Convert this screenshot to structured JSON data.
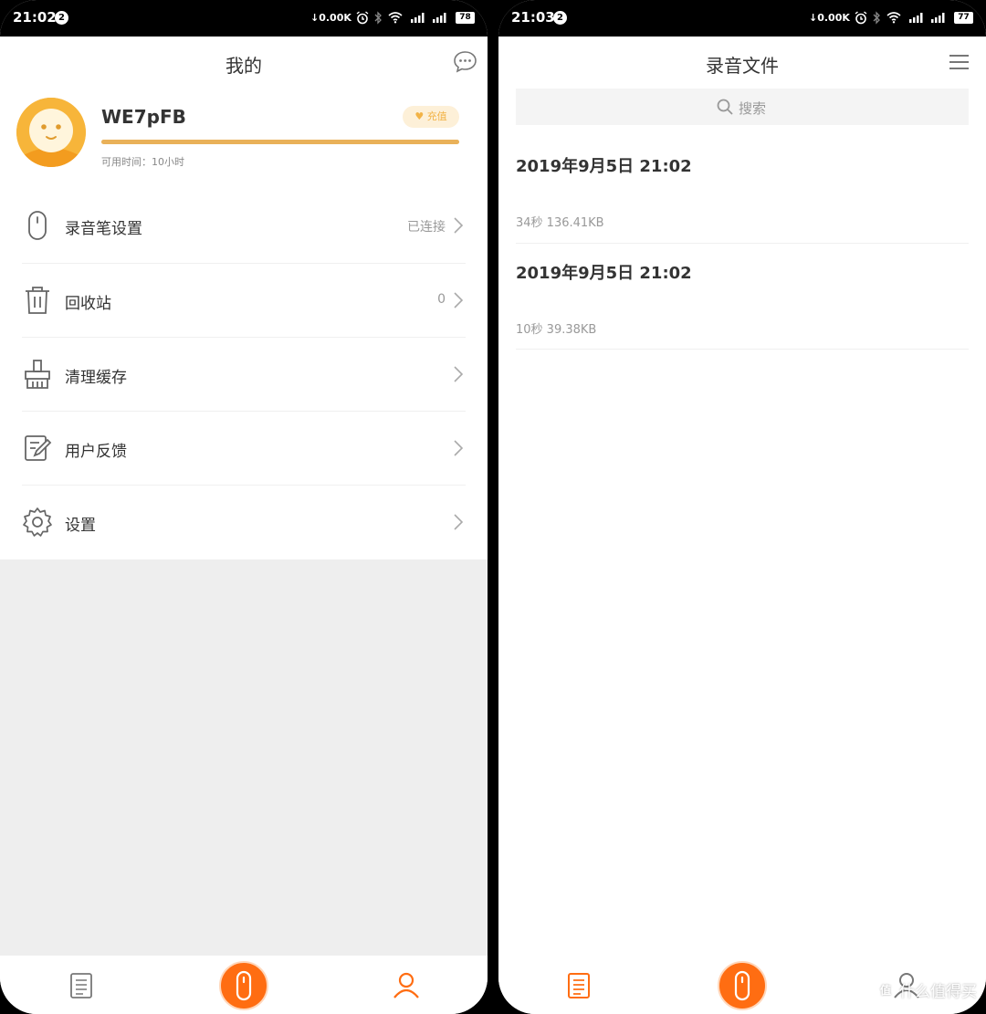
{
  "colors": {
    "accent": "#ff6d12",
    "gold": "#e9b159",
    "vip_bg": "#fdf0d8",
    "grey_bg": "#eeeeee"
  },
  "left": {
    "status": {
      "time": "21:02",
      "notification": "2",
      "speed": "↓0.00K",
      "battery": "78"
    },
    "title": "我的",
    "header_icon": "chat-bubble-icon",
    "profile": {
      "username": "WE7pFB",
      "vip_label": "充值",
      "available_time": "可用时间：10小时",
      "progress_percent": 100
    },
    "menu": [
      {
        "label": "录音笔设置",
        "value": "已连接",
        "icon": "recorder-pen-icon"
      },
      {
        "label": "回收站",
        "value": "0",
        "icon": "trash-icon"
      },
      {
        "label": "清理缓存",
        "value": "",
        "icon": "broom-icon"
      },
      {
        "label": "用户反馈",
        "value": "",
        "icon": "feedback-edit-icon"
      },
      {
        "label": "设置",
        "value": "",
        "icon": "gear-icon"
      }
    ],
    "nav": {
      "selected": "profile"
    }
  },
  "right": {
    "status": {
      "time": "21:03",
      "notification": "2",
      "speed": "↓0.00K",
      "battery": "77"
    },
    "title": "录音文件",
    "search": {
      "placeholder": "搜索"
    },
    "recordings": [
      {
        "title": "2019年9月5日 21:02",
        "meta": "34秒 136.41KB"
      },
      {
        "title": "2019年9月5日 21:02",
        "meta": "10秒 39.38KB"
      }
    ],
    "nav": {
      "selected": "files"
    },
    "watermark": {
      "badge": "值",
      "text": "什么值得买"
    }
  }
}
